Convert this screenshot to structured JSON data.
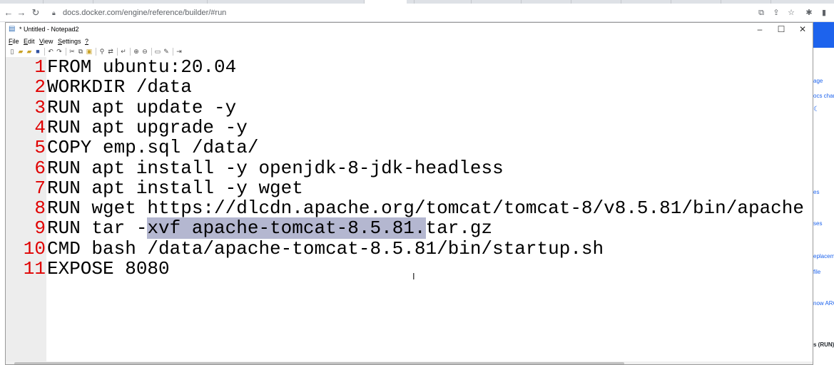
{
  "browser": {
    "url": "docs.docker.com/engine/reference/builder/#run",
    "back_icon": "arrow-left-icon",
    "forward_icon": "arrow-right-icon",
    "reload_icon": "reload-icon"
  },
  "page_sidebar": {
    "snippets": [
      "age",
      "ocs char",
      "es",
      "ses",
      "eplacem",
      "file",
      "now ARC",
      "s (RUN)"
    ]
  },
  "notepad": {
    "title": "* Untitled - Notepad2",
    "window_buttons": {
      "minimize": "–",
      "maximize": "☐",
      "close": "✕"
    },
    "menu": {
      "file": {
        "u": "F",
        "rest": "ile"
      },
      "edit": {
        "u": "E",
        "rest": "dit"
      },
      "view": {
        "u": "V",
        "rest": "iew"
      },
      "settings": {
        "u": "S",
        "rest": "ettings"
      },
      "help": {
        "u": "?",
        "rest": ""
      }
    },
    "lines": [
      {
        "num": "1",
        "text": "FROM ubuntu:20.04"
      },
      {
        "num": "2",
        "text": "WORKDIR /data"
      },
      {
        "num": "3",
        "text": "RUN apt update -y"
      },
      {
        "num": "4",
        "text": "RUN apt upgrade -y"
      },
      {
        "num": "5",
        "text": "COPY emp.sql /data/"
      },
      {
        "num": "6",
        "text": "RUN apt install -y openjdk-8-jdk-headless"
      },
      {
        "num": "7",
        "text": "RUN apt install -y wget"
      },
      {
        "num": "8",
        "text": "RUN wget https://dlcdn.apache.org/tomcat/tomcat-8/v8.5.81/bin/apache"
      },
      {
        "num": "9",
        "before": "RUN tar -",
        "selected": "xvf apache-tomcat-8.5.81.",
        "after": "tar.gz"
      },
      {
        "num": "10",
        "text": "CMD bash /data/apache-tomcat-8.5.81/bin/startup.sh"
      },
      {
        "num": "11",
        "text": "EXPOSE 8080"
      }
    ],
    "colors": {
      "line_number": "#e00000",
      "selection": "#b4b7d0",
      "gutter": "#ededed"
    }
  }
}
